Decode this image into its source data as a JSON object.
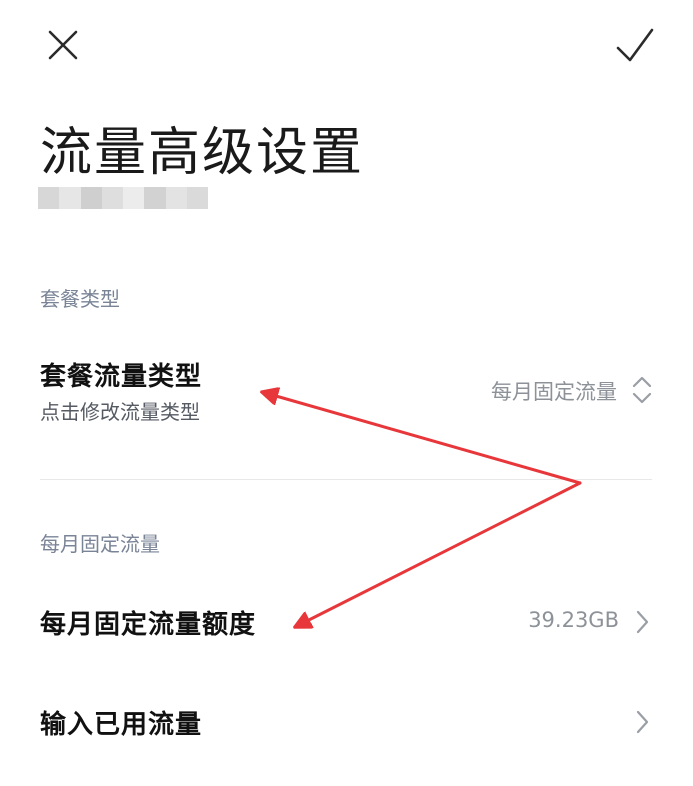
{
  "header": {
    "close_icon": "close-icon",
    "confirm_icon": "check-icon",
    "title": "流量高级设置",
    "redacted_colors": [
      "#d7d7d7",
      "#e6e6e6",
      "#cfcfcf",
      "#dedede",
      "#ececec",
      "#d2d2d2",
      "#e3e3e3",
      "#dadada"
    ]
  },
  "plan_type_section": {
    "header": "套餐类型",
    "row": {
      "title": "套餐流量类型",
      "subtitle": "点击修改流量类型",
      "value": "每月固定流量",
      "icon": "expand-collapse-icon"
    }
  },
  "monthly_section": {
    "header": "每月固定流量",
    "rows": [
      {
        "title": "每月固定流量额度",
        "value": "39.23GB",
        "icon": "chevron-right-icon"
      },
      {
        "title": "输入已用流量",
        "value": "",
        "icon": "chevron-right-icon"
      }
    ]
  },
  "annotation": {
    "arrow_color": "#e8373a",
    "icon_color": "#2b2b2b",
    "chevron_color": "#9a9ea5"
  }
}
